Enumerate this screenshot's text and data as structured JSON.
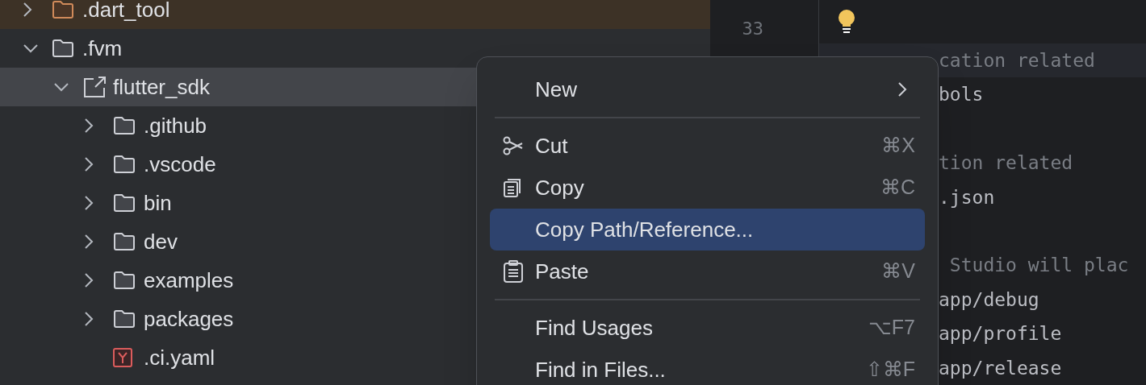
{
  "tree": [
    {
      "name": ".dart_tool",
      "kind": "folder",
      "expanded": false,
      "excluded": true,
      "selected": false
    },
    {
      "name": ".fvm",
      "kind": "folder",
      "expanded": true,
      "excluded": false,
      "selected": false,
      "children": [
        {
          "name": "flutter_sdk",
          "kind": "link",
          "expanded": true,
          "excluded": false,
          "selected": true,
          "children": [
            {
              "name": ".github",
              "kind": "folder",
              "expanded": false,
              "excluded": false,
              "selected": false
            },
            {
              "name": ".vscode",
              "kind": "folder",
              "expanded": false,
              "excluded": false,
              "selected": false
            },
            {
              "name": "bin",
              "kind": "folder",
              "expanded": false,
              "excluded": false,
              "selected": false
            },
            {
              "name": "dev",
              "kind": "folder",
              "expanded": false,
              "excluded": false,
              "selected": false
            },
            {
              "name": "examples",
              "kind": "folder",
              "expanded": false,
              "excluded": false,
              "selected": false
            },
            {
              "name": "packages",
              "kind": "folder",
              "expanded": false,
              "excluded": false,
              "selected": false
            },
            {
              "name": ".ci.yaml",
              "kind": "yaml",
              "excluded": false,
              "selected": false
            }
          ]
        }
      ]
    }
  ],
  "editor": {
    "line_number": "33",
    "intention_bulb": true,
    "lines": [
      {
        "text": "cation related",
        "kind": "comment",
        "current": true
      },
      {
        "text": "bols",
        "kind": "code",
        "current": false
      },
      {
        "kind": "blank",
        "current": false
      },
      {
        "text": "tion related",
        "kind": "comment",
        "current": false
      },
      {
        "text": ".json",
        "kind": "code",
        "current": false
      },
      {
        "kind": "blank",
        "current": false
      },
      {
        "text": " Studio will plac",
        "kind": "comment",
        "current": false
      },
      {
        "text": "app/debug",
        "kind": "code",
        "current": false
      },
      {
        "text": "app/profile",
        "kind": "code",
        "current": false
      },
      {
        "text": "app/release",
        "kind": "code",
        "current": false
      }
    ]
  },
  "context_menu": [
    {
      "kind": "item",
      "label": "New",
      "submenu": true,
      "selected": false
    },
    {
      "kind": "separator"
    },
    {
      "kind": "cut",
      "label": "Cut",
      "shortcut": "⌘X",
      "selected": false
    },
    {
      "kind": "copy",
      "label": "Copy",
      "shortcut": "⌘C",
      "selected": false
    },
    {
      "kind": "item",
      "label": "Copy Path/Reference...",
      "selected": true
    },
    {
      "kind": "paste",
      "label": "Paste",
      "shortcut": "⌘V",
      "selected": false
    },
    {
      "kind": "separator"
    },
    {
      "kind": "item",
      "label": "Find Usages",
      "submenu": false,
      "shortcut": "⌥F7",
      "selected": false
    },
    {
      "kind": "item",
      "label": "Find in Files...",
      "shortcut": "⇧⌘F",
      "selected": false
    }
  ]
}
